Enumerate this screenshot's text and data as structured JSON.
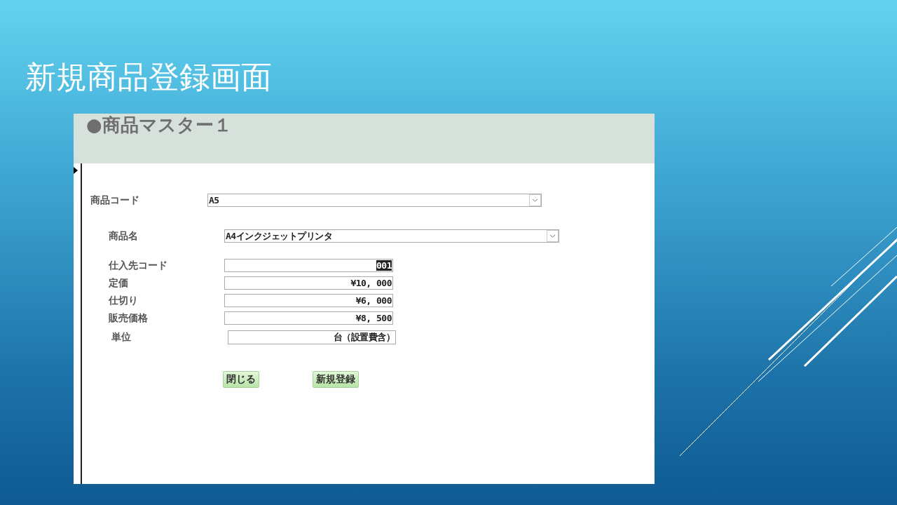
{
  "slide": {
    "title": "新規商品登録画面"
  },
  "form": {
    "title": "●商品マスター１",
    "fields": [
      {
        "kind": "combo",
        "label": "商品コード",
        "value": "A5",
        "text_selected": false
      },
      {
        "kind": "combo",
        "label": "商品名",
        "value": "A4インクジェットプリンタ",
        "text_selected": false
      },
      {
        "kind": "text",
        "label": "仕入先コード",
        "value": "001",
        "text_selected": true
      },
      {
        "kind": "text",
        "label": "定価",
        "value": "¥10, 000",
        "text_selected": false
      },
      {
        "kind": "text",
        "label": "仕切り",
        "value": "¥6, 000",
        "text_selected": false
      },
      {
        "kind": "text",
        "label": "販売価格",
        "value": "¥8, 500",
        "text_selected": false
      },
      {
        "kind": "text",
        "label": "単位",
        "value": "台（設置費含）",
        "text_selected": false
      }
    ],
    "buttons": [
      "閉じる",
      "新規登録"
    ]
  }
}
